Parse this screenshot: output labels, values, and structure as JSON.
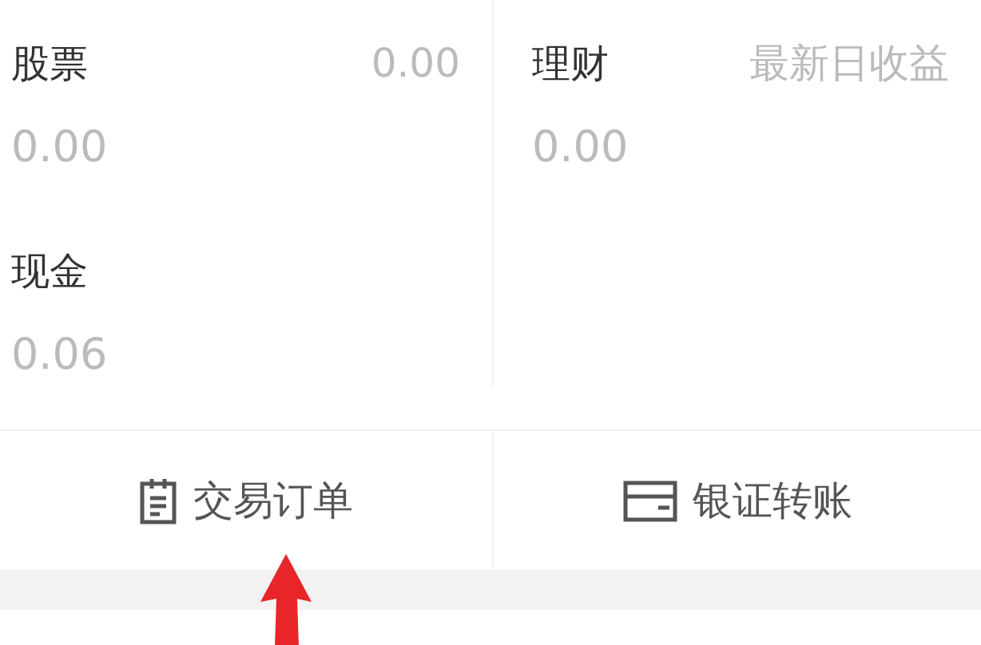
{
  "columns": [
    {
      "items": [
        {
          "label": "股票",
          "aside": "0.00",
          "value": "0.00"
        },
        {
          "label": "现金",
          "value": "0.06"
        }
      ]
    },
    {
      "items": [
        {
          "label": "理财",
          "aside": "最新日收益",
          "value": "0.00"
        }
      ]
    }
  ],
  "actions": [
    {
      "kind": "order",
      "label": "交易订单"
    },
    {
      "kind": "card",
      "label": "银证转账"
    }
  ]
}
